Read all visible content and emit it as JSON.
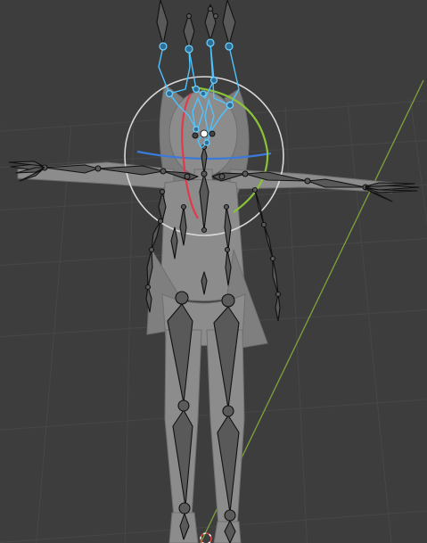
{
  "viewport": {
    "background": "#3d3d3d",
    "grid_color": "#474747",
    "y_axis_color": "#7ea23a",
    "x_axis_color": "#8a3a3a"
  },
  "gizmo": {
    "type": "rotate",
    "outer_ring_color": "#d8d8d8",
    "x_axis_color": "#e23a4a",
    "y_axis_color": "#8bc23a",
    "z_axis_color": "#3a7ad8"
  },
  "armature": {
    "bone_color": "#595959",
    "bone_outline_color": "#111111",
    "selected_bone_color": "#4fc3ff"
  },
  "mesh": {
    "color": "#8c8c8c"
  }
}
